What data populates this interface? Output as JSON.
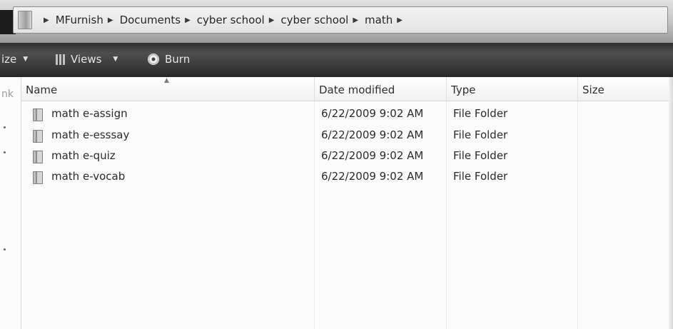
{
  "address_bar": {
    "breadcrumbs": [
      {
        "label": "MFurnish"
      },
      {
        "label": "Documents"
      },
      {
        "label": "cyber school"
      },
      {
        "label": "cyber school"
      },
      {
        "label": "math"
      }
    ],
    "separator": "▶"
  },
  "toolbar": {
    "organize_label": "ize",
    "views_label": "Views",
    "burn_label": "Burn",
    "dropdown_arrow": "▼"
  },
  "nav_pane": {
    "cut_label": "nk"
  },
  "file_list": {
    "columns": {
      "name": "Name",
      "date_modified": "Date modified",
      "type": "Type",
      "size": "Size"
    },
    "sort_indicator": "▲",
    "rows": [
      {
        "name": "math e-assign",
        "date_modified": "6/22/2009 9:02 AM",
        "type": "File Folder",
        "size": ""
      },
      {
        "name": "math e-esssay",
        "date_modified": "6/22/2009 9:02 AM",
        "type": "File Folder",
        "size": ""
      },
      {
        "name": "math e-quiz",
        "date_modified": "6/22/2009 9:02 AM",
        "type": "File Folder",
        "size": ""
      },
      {
        "name": "math e-vocab",
        "date_modified": "6/22/2009 9:02 AM",
        "type": "File Folder",
        "size": ""
      }
    ]
  },
  "icons": {
    "folder": "folder-icon",
    "views": "views-icon",
    "burn": "burn-icon"
  }
}
